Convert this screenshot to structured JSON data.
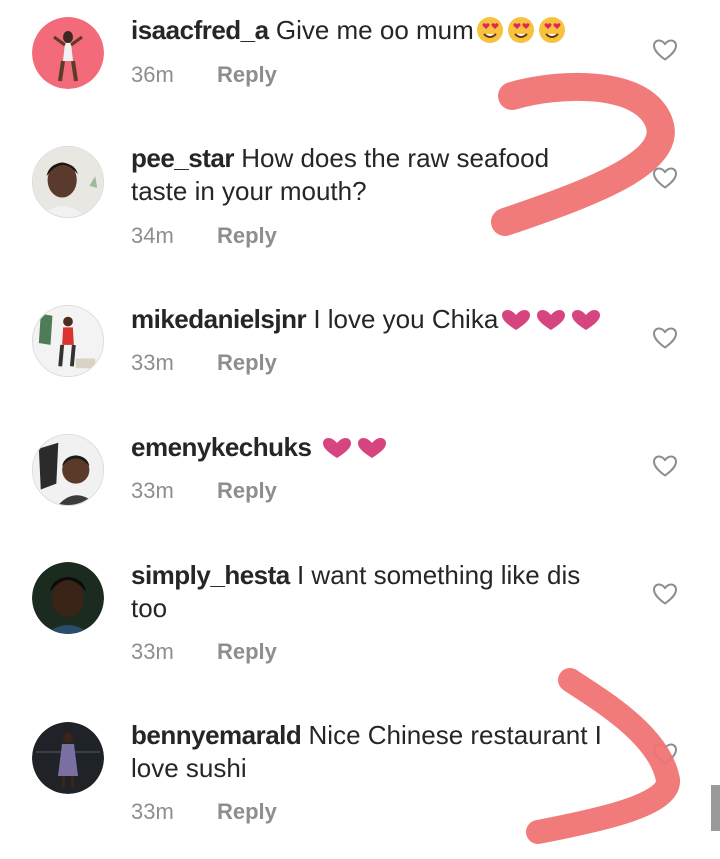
{
  "comments": [
    {
      "username": "isaacfred_a",
      "text": "Give me oo mum",
      "emoji": [
        "heart-eyes",
        "heart-eyes",
        "heart-eyes"
      ],
      "time": "36m",
      "reply": "Reply"
    },
    {
      "username": "pee_star",
      "text": "How does the raw seafood taste in your mouth?",
      "emoji": [],
      "time": "34m",
      "reply": "Reply"
    },
    {
      "username": "mikedanielsjnr",
      "text": "I love you Chika",
      "emoji": [
        "pink-heart",
        "pink-heart",
        "pink-heart"
      ],
      "time": "33m",
      "reply": "Reply"
    },
    {
      "username": "emenykechuks",
      "text": "",
      "emoji": [
        "pink-heart",
        "pink-heart"
      ],
      "time": "33m",
      "reply": "Reply"
    },
    {
      "username": "simply_hesta",
      "text": "I want something like dis too",
      "emoji": [],
      "time": "33m",
      "reply": "Reply"
    },
    {
      "username": "bennyemarald",
      "text": "Nice Chinese restaurant I love sushi",
      "emoji": [],
      "time": "33m",
      "reply": "Reply"
    }
  ],
  "colors": {
    "text": "#262626",
    "meta": "#8e8e8e",
    "heart_outline": "#8e8e8e",
    "emoji_heart": "#d6457f",
    "annotation_marker": "#f07474"
  },
  "icons": [
    "like-heart-outline-icon",
    "heart-eyes-emoji",
    "pink-heart-emoji"
  ]
}
